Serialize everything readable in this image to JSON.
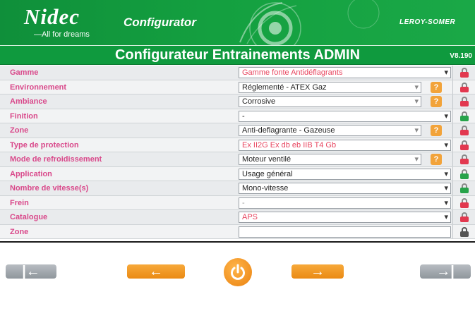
{
  "header": {
    "brand": "Nidec",
    "tagline": "All for dreams",
    "product": "Configurator",
    "partner_brand": "LEROY-SOMER"
  },
  "titlebar": {
    "title": "Configurateur Entrainements ADMIN",
    "version": "V8.190"
  },
  "rows": [
    {
      "label": "Gamme",
      "value": "Gamme fonte Antidéflagrants",
      "value_color": "red",
      "has_help": false,
      "lock": "red"
    },
    {
      "label": "Environnement",
      "value": "Réglementé - ATEX Gaz",
      "value_color": "normal",
      "has_help": true,
      "help": "?",
      "lock": "red"
    },
    {
      "label": "Ambiance",
      "value": "Corrosive",
      "value_color": "normal",
      "has_help": true,
      "help": "?",
      "lock": "red"
    },
    {
      "label": "Finition",
      "value": "-",
      "value_color": "normal",
      "has_help": false,
      "lock": "green"
    },
    {
      "label": "Zone",
      "value": "Anti-deflagrante - Gazeuse",
      "value_color": "normal",
      "has_help": true,
      "help": "?",
      "lock": "red"
    },
    {
      "label": "Type de protection",
      "value": "Ex II2G Ex db eb IIB T4 Gb",
      "value_color": "red",
      "has_help": false,
      "lock": "red"
    },
    {
      "label": "Mode de refroidissement",
      "value": "Moteur ventilé",
      "value_color": "normal",
      "has_help": true,
      "help": "?",
      "lock": "red"
    },
    {
      "label": "Application",
      "value": "Usage général",
      "value_color": "normal",
      "has_help": false,
      "lock": "green"
    },
    {
      "label": "Nombre de vitesse(s)",
      "value": "Mono-vitesse",
      "value_color": "normal",
      "has_help": false,
      "lock": "green"
    },
    {
      "label": "Frein",
      "value": "-",
      "value_color": "grey",
      "has_help": false,
      "lock": "red"
    },
    {
      "label": "Catalogue",
      "value": "APS",
      "value_color": "red",
      "has_help": false,
      "lock": "red"
    },
    {
      "label": "Zone",
      "value": "",
      "value_color": "normal",
      "has_help": false,
      "lock": "dark"
    }
  ],
  "nav": {
    "first": "|←",
    "prev": "←",
    "next": "→",
    "last": "→|"
  },
  "colors": {
    "brand_green": "#0f9a3e",
    "label_pink": "#d9488a",
    "value_red": "#e8455f",
    "help_orange": "#f2a33a",
    "nav_orange": "#ea8a14",
    "nav_grey": "#8f969c"
  }
}
